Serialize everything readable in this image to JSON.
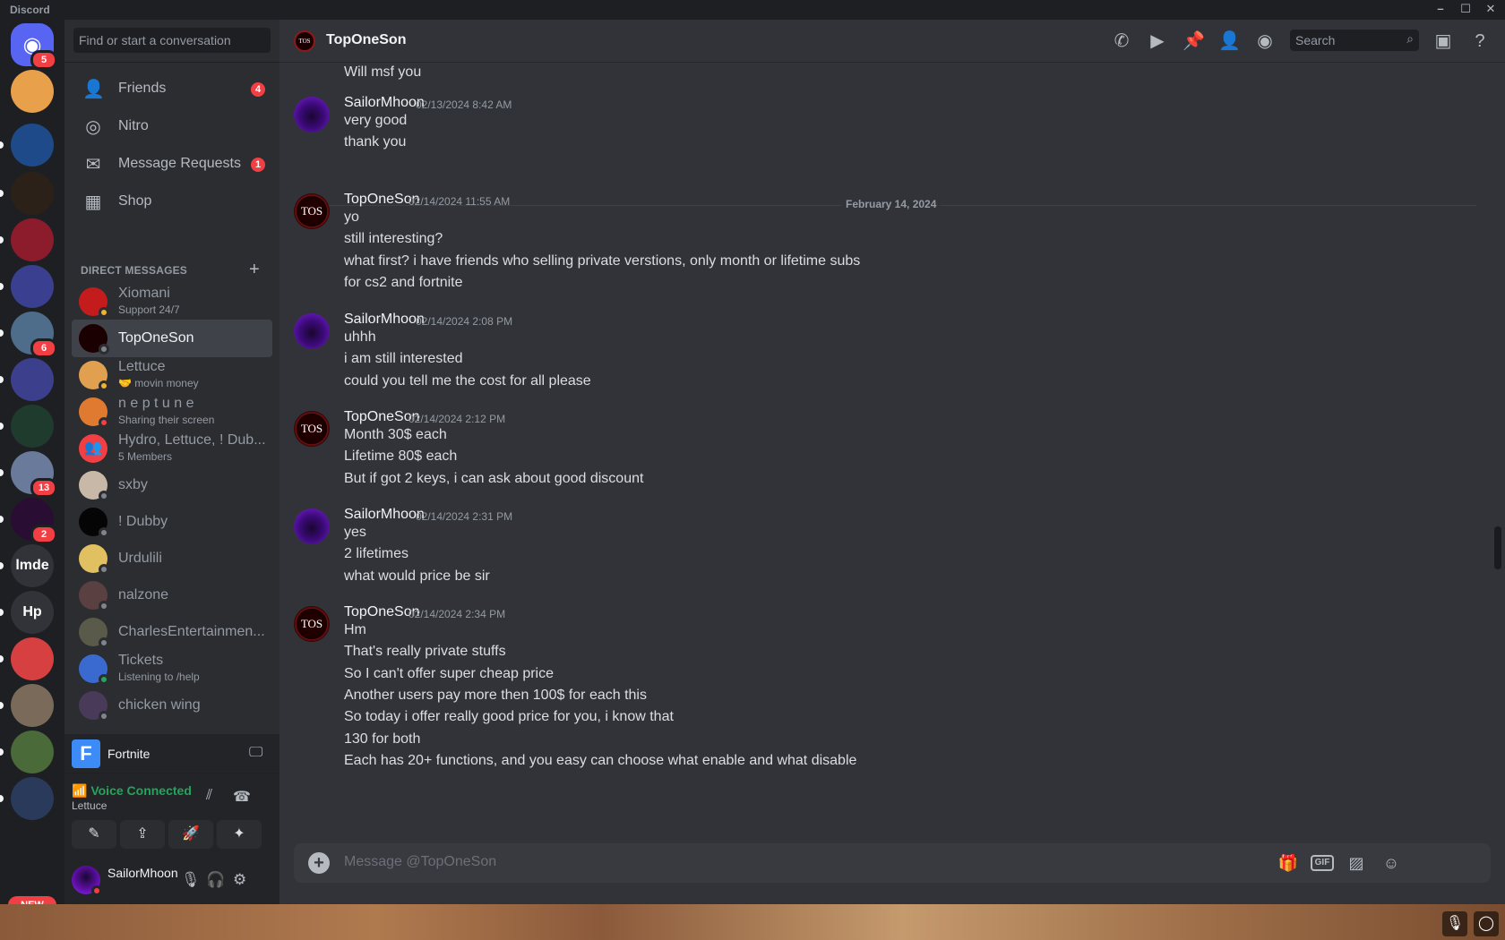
{
  "window": {
    "title": "Discord"
  },
  "guilds": {
    "new_label": "NEW",
    "items": [
      {
        "name": "home",
        "badge": "5",
        "color": "#5865f2"
      },
      {
        "name": "server-cartoon",
        "badge": "",
        "color": "#e8a04a"
      },
      {
        "name": "server-target",
        "badge": "",
        "color": "#1e4a8a"
      },
      {
        "name": "server-gold-logo",
        "badge": "",
        "color": "#2b2118"
      },
      {
        "name": "server-red-hammer",
        "badge": "",
        "color": "#8c1c2c"
      },
      {
        "name": "server-ebg",
        "badge": "",
        "color": "#3a3f8f"
      },
      {
        "name": "server-academy",
        "badge": "6",
        "color": "#4e6d8a"
      },
      {
        "name": "server-anime",
        "badge": "",
        "color": "#3b3f8c"
      },
      {
        "name": "server-varks",
        "badge": "",
        "color": "#1f3b2e"
      },
      {
        "name": "server-panda",
        "badge": "13",
        "color": "#6a7a9a"
      },
      {
        "name": "server-zreal",
        "badge": "2",
        "color": "#2a0d33"
      },
      {
        "name": "server-lmde",
        "text": "lmde",
        "badge": "",
        "color": "#313338"
      },
      {
        "name": "server-hp",
        "text": "Hp",
        "badge": "",
        "color": "#313338"
      },
      {
        "name": "server-srp",
        "badge": "",
        "color": "#d64040"
      },
      {
        "name": "server-game",
        "badge": "",
        "color": "#7a6a5a"
      },
      {
        "name": "server-ghost",
        "badge": "",
        "color": "#4a6a3a"
      },
      {
        "name": "server-robot",
        "badge": "",
        "color": "#2a3a5a"
      }
    ]
  },
  "dm_sidebar": {
    "search_placeholder": "Find or start a conversation",
    "nav": [
      {
        "label": "Friends",
        "badge": "4",
        "icon": "friends-icon"
      },
      {
        "label": "Nitro",
        "badge": "",
        "icon": "nitro-icon"
      },
      {
        "label": "Message Requests",
        "badge": "1",
        "icon": "envelope-icon"
      },
      {
        "label": "Shop",
        "badge": "",
        "icon": "shop-icon"
      }
    ],
    "section_title": "DIRECT MESSAGES",
    "dms": [
      {
        "name": "Xiomani",
        "sub": "Support 24/7",
        "status": "idle",
        "color": "#c41c1c"
      },
      {
        "name": "TopOneSon",
        "sub": "",
        "status": "offline",
        "color": "#1a0000",
        "active": true
      },
      {
        "name": "Lettuce",
        "sub": "🤝 movin money",
        "status": "idle",
        "color": "#e0a050"
      },
      {
        "name": "n e p t u n e",
        "sub": "Sharing their screen",
        "status": "dnd",
        "color": "#e07a30"
      },
      {
        "name": "Hydro, Lettuce, ! Dub...",
        "sub": "5 Members",
        "status": "group",
        "color": "#f23f43"
      },
      {
        "name": "sxby",
        "sub": "",
        "status": "offline",
        "color": "#c8b8a8"
      },
      {
        "name": "! Dubby",
        "sub": "",
        "status": "offline",
        "color": "#050505"
      },
      {
        "name": "Urdulili",
        "sub": "",
        "status": "offline",
        "color": "#e0c060"
      },
      {
        "name": "nalzone",
        "sub": "",
        "status": "offline",
        "color": "#5a4040"
      },
      {
        "name": "CharlesEntertainmen...",
        "sub": "",
        "status": "offline",
        "color": "#5a5a4a"
      },
      {
        "name": "Tickets",
        "sub": "Listening to /help",
        "status": "online",
        "color": "#3a6ad0"
      },
      {
        "name": "chicken wing",
        "sub": "",
        "status": "offline",
        "color": "#4a3a5a"
      }
    ],
    "activity": {
      "label": "Fortnite",
      "icon_letter": "F"
    },
    "voice": {
      "status": "Voice Connected",
      "channel": "Lettuce"
    },
    "user": {
      "name": "SailorMhoon"
    }
  },
  "chat": {
    "recipient": "TopOneSon",
    "header_avatar_text": "TOS",
    "search_placeholder": "Search",
    "top_line": "Will msf you",
    "date_divider": "February 14, 2024",
    "messages": [
      {
        "author": "SailorMhoon",
        "time": "02/13/2024 8:42 AM",
        "avatar": "sm",
        "lines": [
          "very good",
          "thank you"
        ]
      },
      {
        "author": "TopOneSon",
        "time": "02/14/2024 11:55 AM",
        "avatar": "tos",
        "lines": [
          "yo",
          "still interesting?",
          "what first? i have friends who selling private verstions, only month or lifetime subs",
          "for cs2 and fortnite"
        ]
      },
      {
        "author": "SailorMhoon",
        "time": "02/14/2024 2:08 PM",
        "avatar": "sm",
        "lines": [
          "uhhh",
          "i am still interested",
          "could you tell me the cost for all please"
        ]
      },
      {
        "author": "TopOneSon",
        "time": "02/14/2024 2:12 PM",
        "avatar": "tos",
        "lines": [
          "Month 30$ each",
          "Lifetime 80$ each",
          "But if got 2 keys, i can ask about good discount"
        ]
      },
      {
        "author": "SailorMhoon",
        "time": "02/14/2024 2:31 PM",
        "avatar": "sm",
        "lines": [
          "yes",
          "2 lifetimes",
          "what would price be sir"
        ]
      },
      {
        "author": "TopOneSon",
        "time": "02/14/2024 2:34 PM",
        "avatar": "tos",
        "lines": [
          "Hm",
          "That's really private stuffs",
          "So I can't offer super cheap price",
          "Another users pay more then 100$ for each this",
          "So today i offer really good price for you, i know that",
          "130 for both",
          "Each has 20+ functions, and you easy can choose what enable and what disable"
        ]
      }
    ],
    "composer_placeholder": "Message @TopOneSon",
    "gif_label": "GIF"
  }
}
